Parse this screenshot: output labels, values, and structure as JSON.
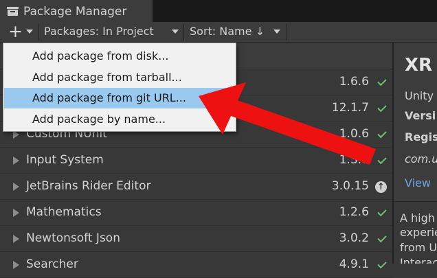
{
  "window": {
    "title": "Package Manager"
  },
  "toolbar": {
    "add_label": "+",
    "filter_label": "Packages: In Project",
    "sort_label": "Sort: Name ↓"
  },
  "add_menu": {
    "items": [
      {
        "label": "Add package from disk..."
      },
      {
        "label": "Add package from tarball..."
      },
      {
        "label": "Add package from git URL..."
      },
      {
        "label": "Add package by name..."
      }
    ],
    "selected_index": 2
  },
  "packages": [
    {
      "name": "",
      "version": "1.6.6",
      "status": "installed"
    },
    {
      "name": "",
      "version": "12.1.7",
      "status": "installed"
    },
    {
      "name": "Custom NUnit",
      "version": "1.0.6",
      "status": "installed"
    },
    {
      "name": "Input System",
      "version": "1.3.0",
      "status": "installed"
    },
    {
      "name": "JetBrains Rider Editor",
      "version": "3.0.15",
      "status": "update-available"
    },
    {
      "name": "Mathematics",
      "version": "1.2.6",
      "status": "installed"
    },
    {
      "name": "Newtonsoft Json",
      "version": "3.0.2",
      "status": "installed"
    },
    {
      "name": "Searcher",
      "version": "4.9.1",
      "status": "installed"
    }
  ],
  "detail": {
    "title": "XR",
    "author": "Unity",
    "version_label": "Versi",
    "registry_label": "Regis",
    "package_id": "com.u",
    "view_link": "View",
    "description": [
      "A high",
      "experie",
      "from U",
      "Interac"
    ]
  },
  "colors": {
    "selection": "#99c9ef",
    "check": "#6fc16f",
    "annotation_arrow": "#ee1111",
    "link": "#6ea5e8"
  },
  "icons": {
    "tab": "package-manager-icon",
    "installed": "checkmark-icon",
    "update": "update-arrow-icon",
    "expand": "expand-triangle-icon"
  }
}
